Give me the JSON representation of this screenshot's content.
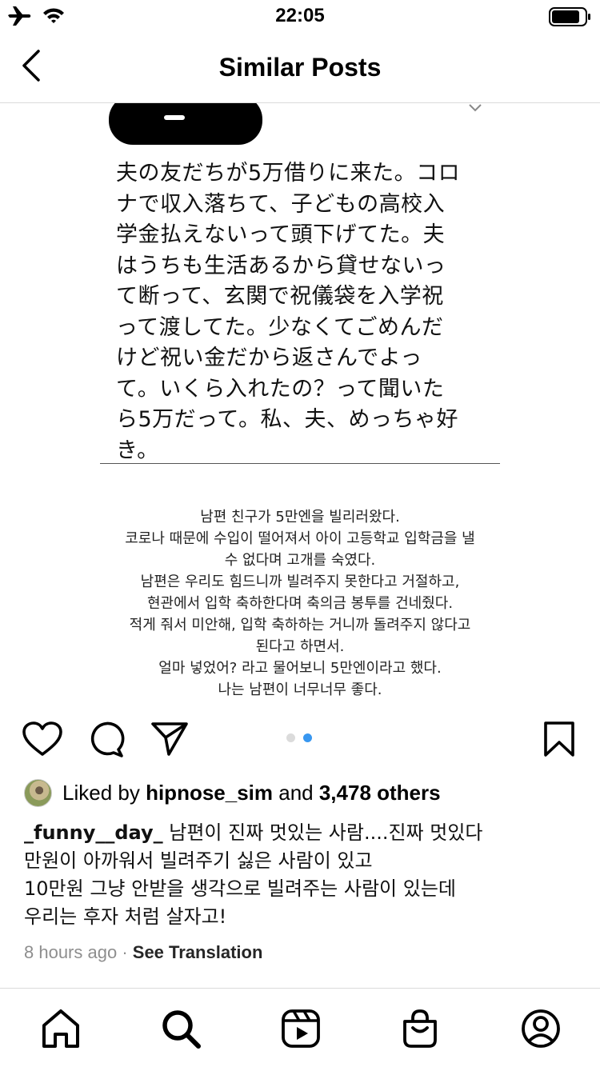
{
  "status_bar": {
    "time": "22:05"
  },
  "nav": {
    "title": "Similar Posts"
  },
  "post": {
    "tweet_text_lines": [
      "夫の友だちが5万借りに来た。コロ",
      "ナで収入落ちて、子どもの高校入",
      "学金払えないって頭下げてた。夫",
      "はうちも生活あるから貸せないっ",
      "て断って、玄関で祝儀袋を入学祝",
      "って渡してた。少なくてごめんだ",
      "けど祝い金だから返さんでよっ",
      "て。いくら入れたの？って聞いた",
      "ら5万だって。私、夫、めっちゃ好",
      "き。"
    ],
    "translation_lines": [
      "남편 친구가 5만엔을 빌리러왔다.",
      "코로나 때문에 수입이 떨어져서 아이 고등학교 입학금을 낼",
      "수 없다며 고개를 숙였다.",
      "남편은 우리도 힘드니까 빌려주지 못한다고 거절하고,",
      "현관에서 입학 축하한다며 축의금 봉투를 건네줬다.",
      "적게 줘서 미안해, 입학 축하하는 거니까 돌려주지 않다고",
      "된다고 하면서.",
      "얼마 넣었어? 라고 물어보니 5만엔이라고 했다.",
      "나는 남편이 너무너무 좋다."
    ],
    "carousel": {
      "count": 2,
      "active_index": 1,
      "active_color": "#3897f0",
      "inactive_color": "#dbdbdb"
    }
  },
  "likes": {
    "prefix": "Liked by ",
    "user": "hipnose_sim",
    "middle": " and ",
    "others": "3,478 others"
  },
  "caption": {
    "username": "_funny__day_",
    "first_line_rest": " 남편이 진짜 멋있는 사람....진짜 멋있다",
    "lines": [
      "만원이 아까워서 빌려주기 싫은 사람이 있고",
      "10만원 그냥 안받을 생각으로 빌려주는 사람이 있는데",
      "우리는 후자 처럼 살자고!"
    ]
  },
  "meta": {
    "time_ago": "8 hours ago",
    "separator": " · ",
    "see_translation": "See Translation"
  },
  "icons": {
    "status": [
      "airplane-icon",
      "wifi-icon",
      "battery-icon"
    ],
    "actions": [
      "heart-icon",
      "comment-icon",
      "share-icon",
      "bookmark-icon"
    ],
    "tabs": [
      "home-icon",
      "search-icon",
      "reels-icon",
      "shop-icon",
      "profile-icon"
    ]
  }
}
